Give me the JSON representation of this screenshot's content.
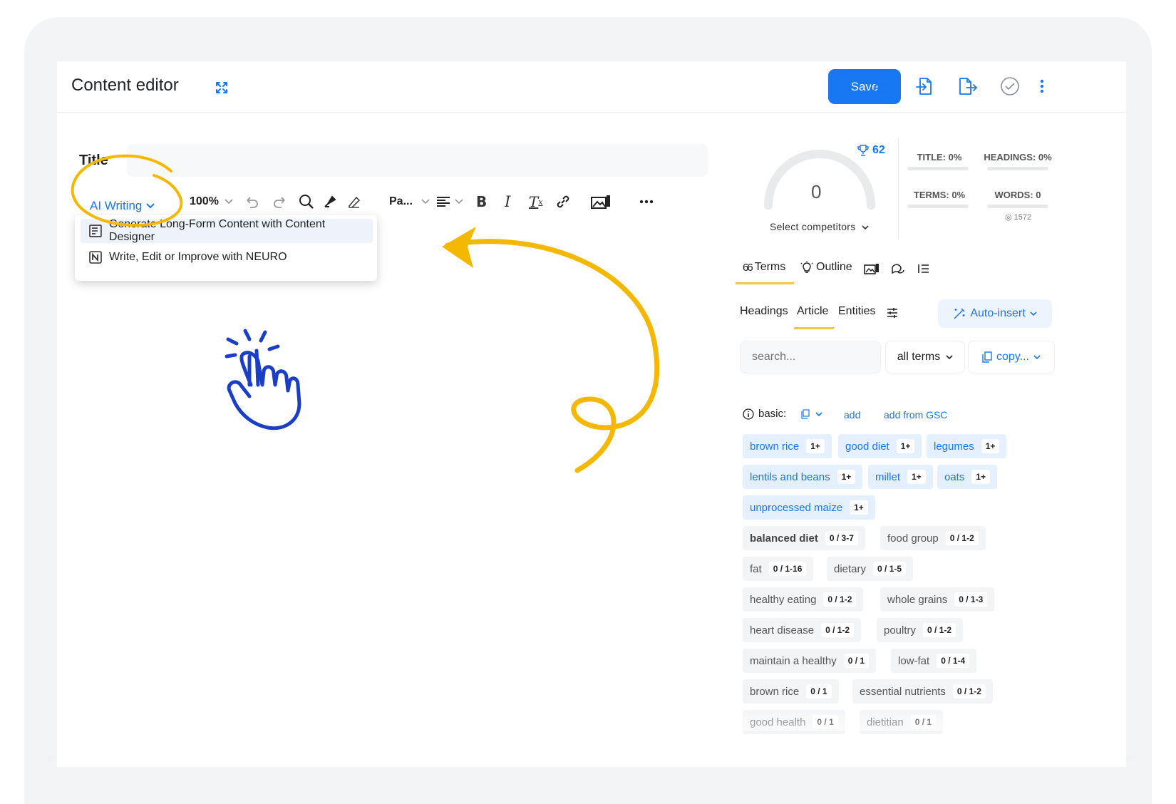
{
  "header": {
    "title": "Content editor",
    "save_label": "Save"
  },
  "editor": {
    "title_label": "Title",
    "ai_writing_label": "AI Writing",
    "zoom": "100%",
    "paragraph_style": "Pa...",
    "menu": [
      {
        "label": "Generate Long-Form Content with Content Designer",
        "icon": "document-list-icon"
      },
      {
        "label": "Write, Edit or Improve with NEURO",
        "icon": "neuro-icon"
      }
    ]
  },
  "score": {
    "value": "0",
    "trophy_value": "62",
    "select_competitors": "Select competitors",
    "stats": {
      "title": "TITLE: 0%",
      "headings": "HEADINGS: 0%",
      "terms": "TERMS: 0%",
      "words": "WORDS: 0",
      "words_sub": "1572"
    }
  },
  "panel_tabs": [
    "Terms",
    "Outline"
  ],
  "sub_tabs": [
    "Headings",
    "Article",
    "Entities"
  ],
  "auto_insert": "Auto-insert",
  "search": {
    "placeholder": "search..."
  },
  "filter": "all terms",
  "copy": "copy...",
  "basic": {
    "label": "basic:",
    "add": "add",
    "add_gsc": "add from GSC"
  },
  "terms_used": [
    {
      "term": "brown rice",
      "count": "1+"
    },
    {
      "term": "good diet",
      "count": "1+"
    },
    {
      "term": "legumes",
      "count": "1+"
    },
    {
      "term": "lentils and beans",
      "count": "1+"
    },
    {
      "term": "millet",
      "count": "1+"
    },
    {
      "term": "oats",
      "count": "1+"
    },
    {
      "term": "unprocessed maize",
      "count": "1+"
    }
  ],
  "terms_missing": [
    {
      "term": "balanced diet",
      "count": "0 / 3-7"
    },
    {
      "term": "food group",
      "count": "0 / 1-2"
    },
    {
      "term": "fat",
      "count": "0 / 1-16"
    },
    {
      "term": "dietary",
      "count": "0 / 1-5"
    },
    {
      "term": "healthy eating",
      "count": "0 / 1-2"
    },
    {
      "term": "whole grains",
      "count": "0 / 1-3"
    },
    {
      "term": "heart disease",
      "count": "0 / 1-2"
    },
    {
      "term": "poultry",
      "count": "0 / 1-2"
    },
    {
      "term": "maintain a healthy",
      "count": "0 / 1"
    },
    {
      "term": "low-fat",
      "count": "0 / 1-4"
    },
    {
      "term": "brown rice",
      "count": "0 / 1"
    },
    {
      "term": "essential nutrients",
      "count": "0 / 1-2"
    },
    {
      "term": "good health",
      "count": "0 / 1"
    },
    {
      "term": "dietitian",
      "count": "0 / 1"
    }
  ],
  "colors": {
    "accent": "#1877f2",
    "highlight": "#f5b800",
    "chip_blue": "#e4f0fd"
  }
}
